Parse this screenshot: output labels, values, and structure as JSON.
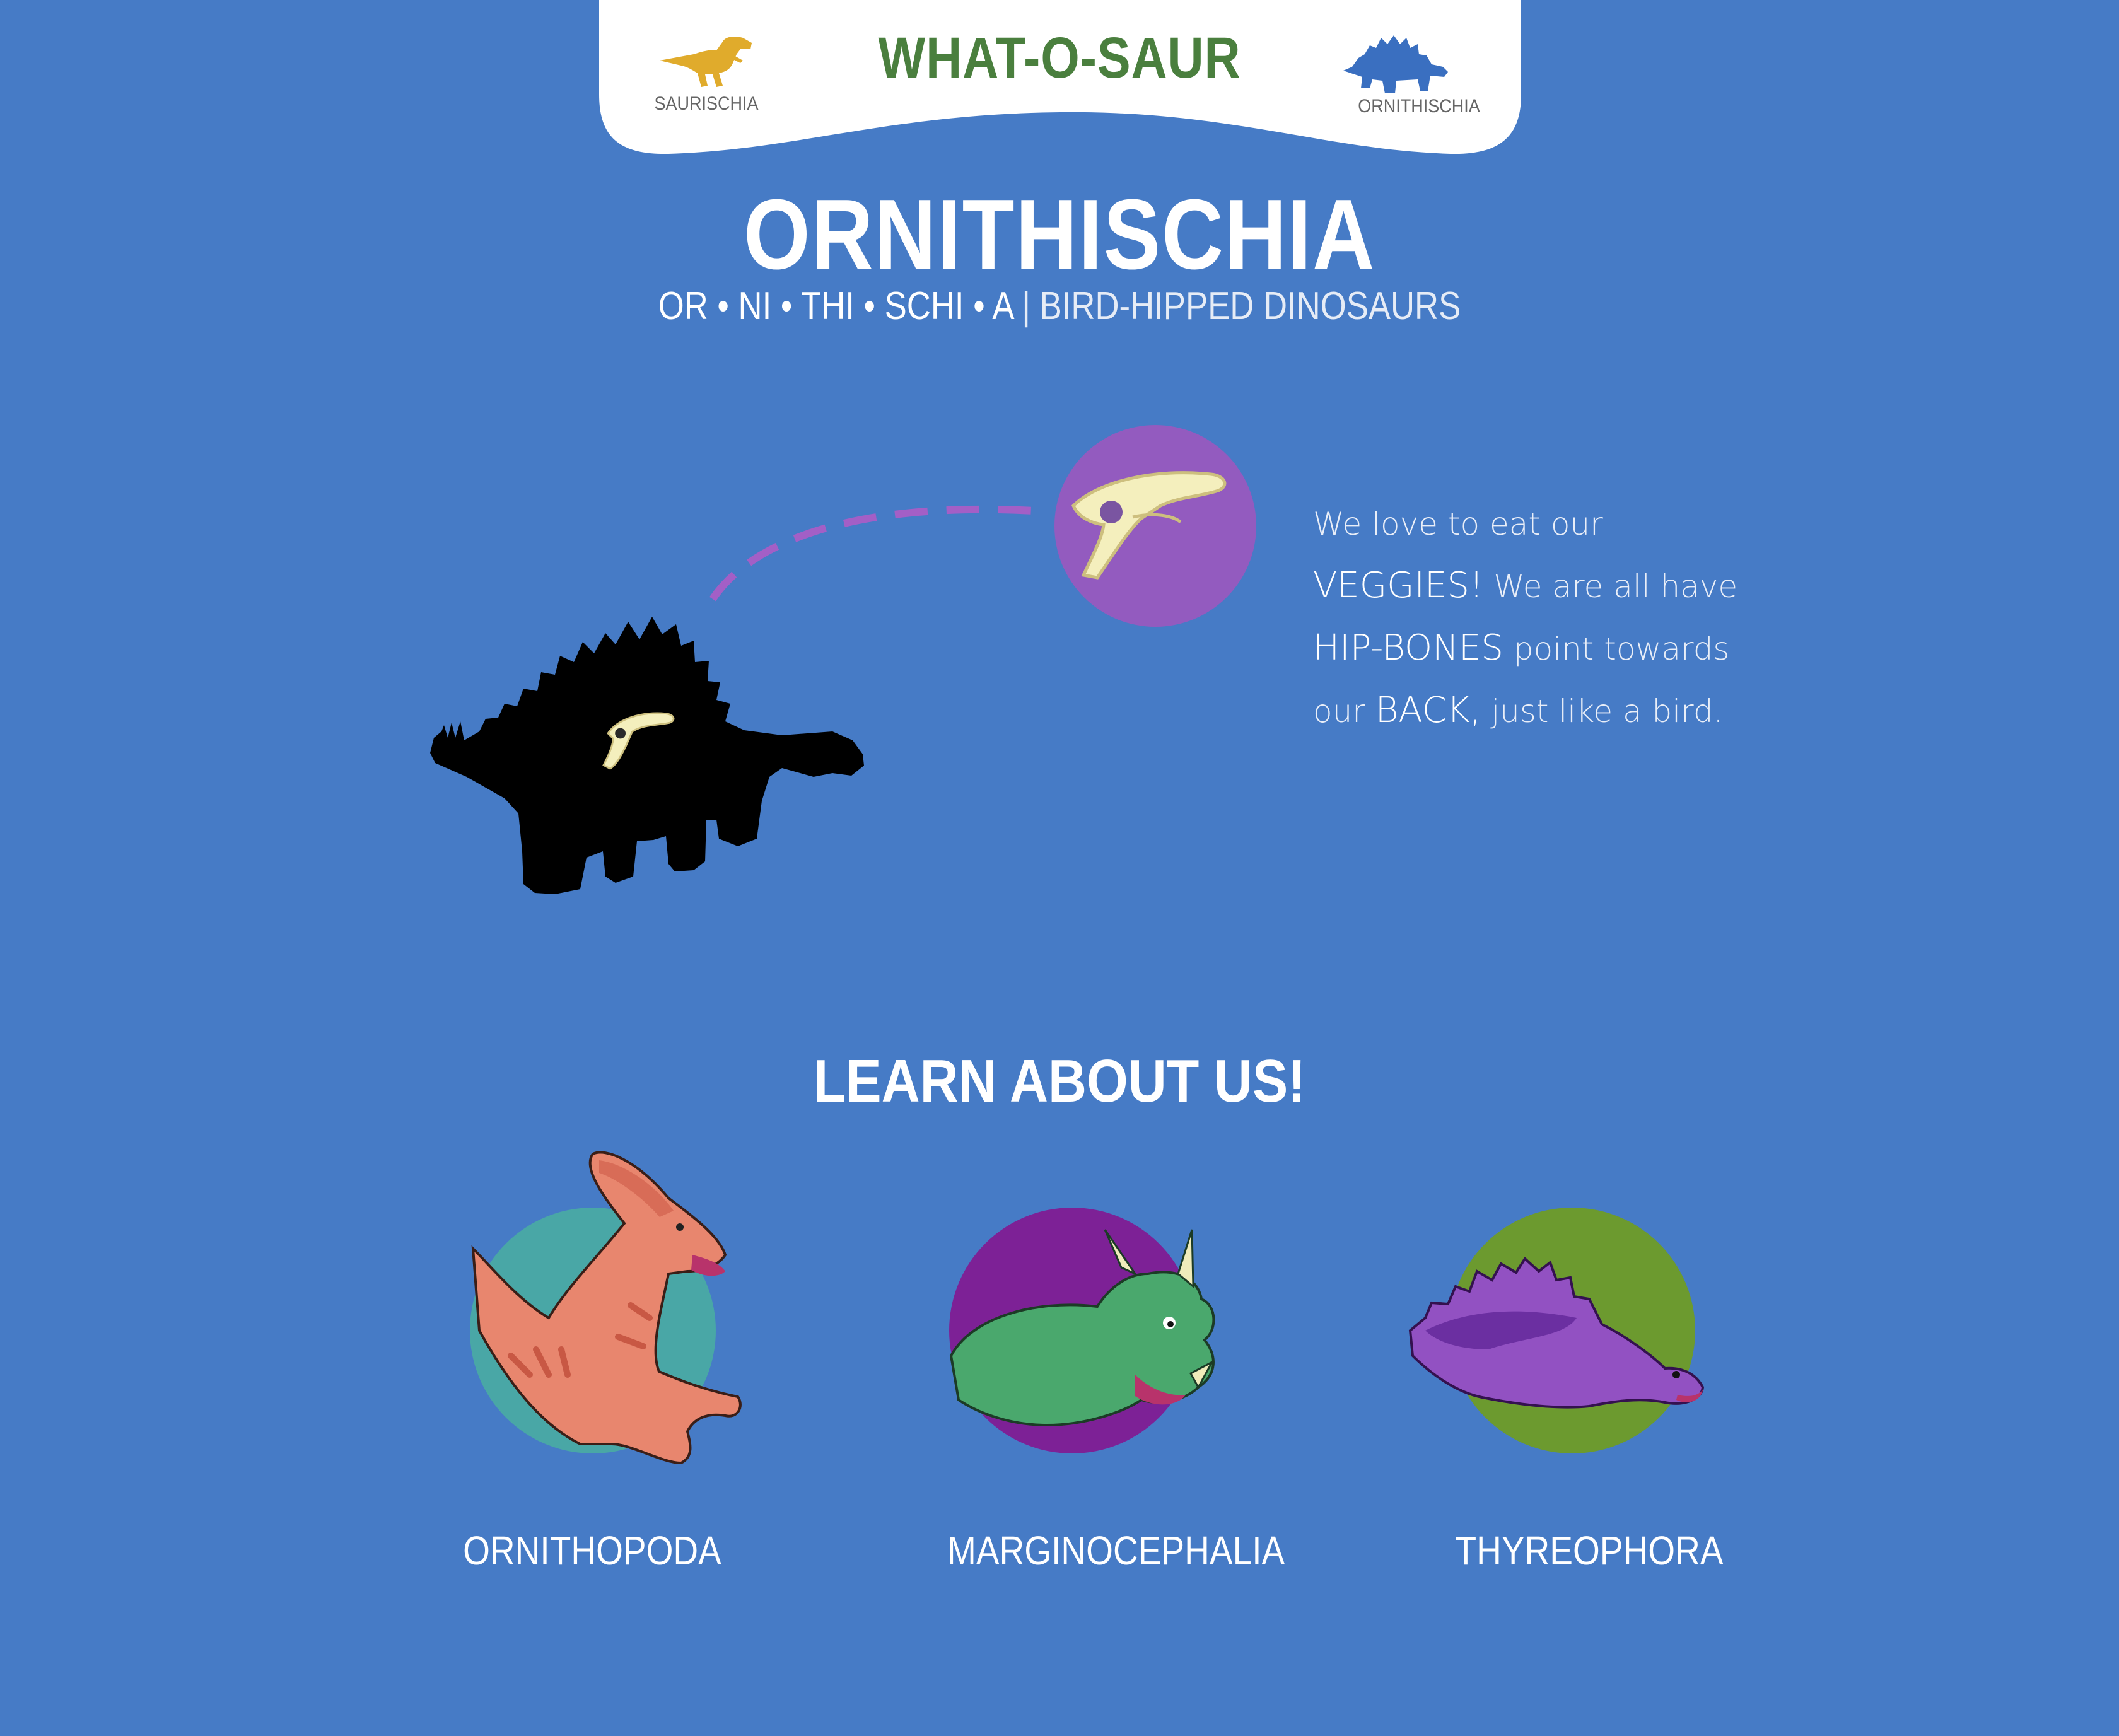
{
  "nav": {
    "brand": "WHAT-O-SAUR",
    "left_label": "SAURISCHIA",
    "right_label": "ORNITHISCHIA"
  },
  "hero": {
    "title": "ORNITHISCHIA",
    "syllables": [
      "OR",
      "NI",
      "THI",
      "SCHI",
      "A"
    ],
    "subtitle": "BIRD-HIPPED DINOSAURS"
  },
  "description": {
    "p1": "We love to eat our",
    "veggies": "VEGGIES!",
    "p2": "We are all have",
    "hipbones": "HIP-BONES",
    "p3": "point towards",
    "p4": "our",
    "back": "BACK,",
    "p5": "just like a bird."
  },
  "learn": {
    "title": "LEARN ABOUT US!",
    "groups": [
      {
        "label": "ORNITHOPODA",
        "circle_color": "#49a7a6"
      },
      {
        "label": "MARGINOCEPHALIA",
        "circle_color": "#7d2196"
      },
      {
        "label": "THYREOPHORA",
        "circle_color": "#6c9a2f"
      }
    ]
  },
  "colors": {
    "background": "#467bc6",
    "brand_green": "#4a7f3e",
    "saurischia_icon": "#e0ab2c",
    "ornithischia_icon": "#3a6fc0",
    "hip_circle": "#935bbf",
    "bone": "#f4efbd"
  }
}
